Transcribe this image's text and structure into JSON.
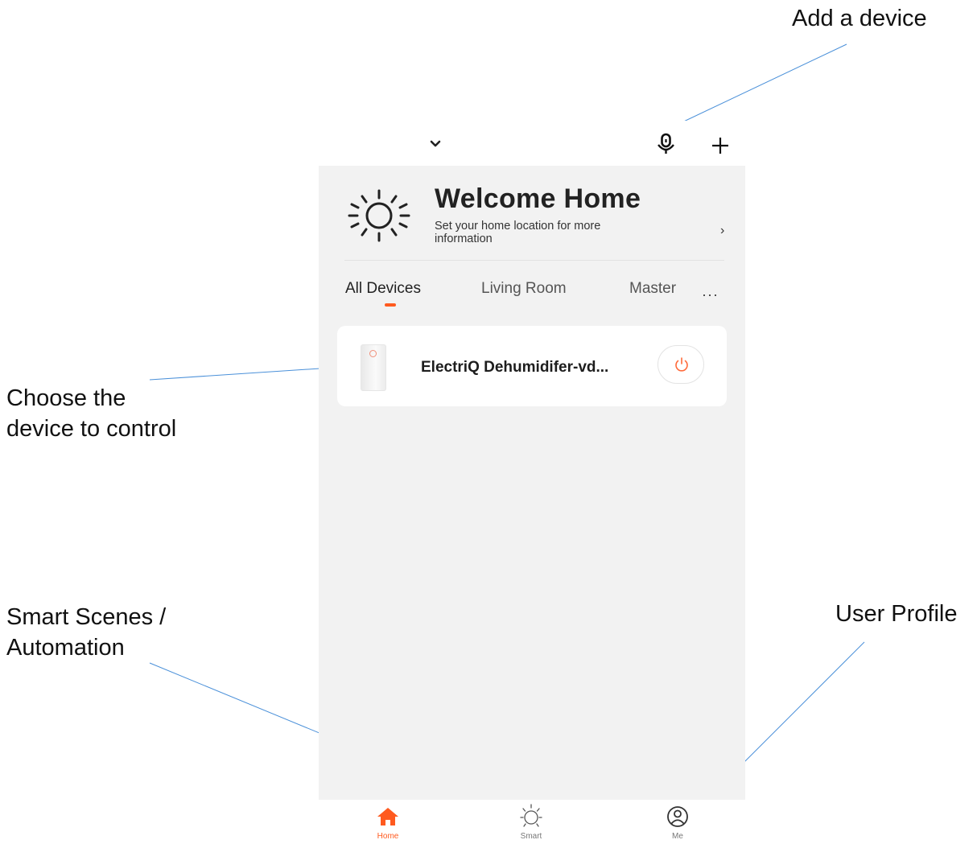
{
  "annotations": {
    "add_device": "Add a device",
    "choose_device_line1": "Choose the",
    "choose_device_line2": "device to control",
    "smart_scenes_line1": "Smart Scenes /",
    "smart_scenes_line2": "Automation",
    "user_profile": "User Profile"
  },
  "header": {
    "home_selector_icon": "chevron-down-icon",
    "voice_icon": "microphone-icon",
    "add_icon": "plus-icon"
  },
  "welcome": {
    "icon": "sun-icon",
    "title": "Welcome Home",
    "subtitle": "Set your home location for more information",
    "arrow": "›"
  },
  "tabs": {
    "items": [
      {
        "label": "All Devices",
        "active": true
      },
      {
        "label": "Living Room",
        "active": false
      },
      {
        "label": "Master",
        "active": false
      }
    ],
    "more": "···"
  },
  "devices": [
    {
      "name": "ElectriQ Dehumidifer-vd...",
      "icon": "dehumidifier-image",
      "power_icon": "power-icon"
    }
  ],
  "bottom_nav": [
    {
      "label": "Home",
      "icon": "home-icon",
      "active": true
    },
    {
      "label": "Smart",
      "icon": "sun-icon",
      "active": false
    },
    {
      "label": "Me",
      "icon": "user-icon",
      "active": false
    }
  ],
  "colors": {
    "accent": "#ff5a1f",
    "screen_bg": "#f2f2f2",
    "annotation_line": "#4a90d9"
  }
}
